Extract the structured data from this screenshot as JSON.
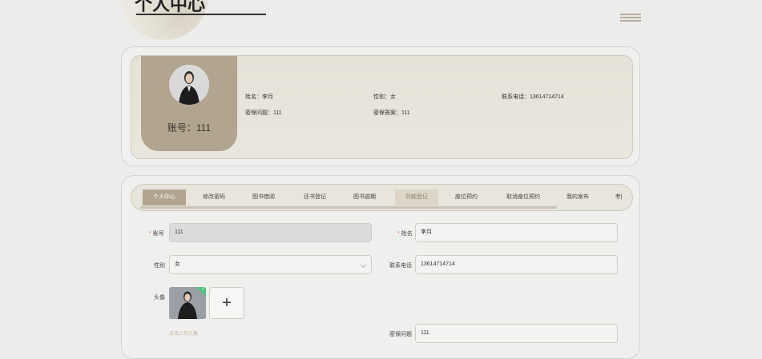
{
  "page": {
    "title": "个人中心"
  },
  "profile": {
    "account_label": "账号：",
    "account_value": "111",
    "name_label": "姓名：",
    "name_value": "李月",
    "gender_label": "性别：",
    "gender_value": "女",
    "phone_label": "联系电话：",
    "phone_value": "13614714714",
    "security_q_label": "密保问题：",
    "security_q_value": "111",
    "security_a_label": "密保答案：",
    "security_a_value": "111"
  },
  "tabs": [
    {
      "label": "个人中心"
    },
    {
      "label": "修改密码"
    },
    {
      "label": "图书借阅"
    },
    {
      "label": "还书登记"
    },
    {
      "label": "图书逾期"
    },
    {
      "label": "罚款登记"
    },
    {
      "label": "座位预约"
    },
    {
      "label": "取消座位预约"
    },
    {
      "label": "我的发布"
    },
    {
      "label": "考|"
    }
  ],
  "form": {
    "account": {
      "label": "账号",
      "value": "111"
    },
    "name": {
      "label": "姓名",
      "value": "李月"
    },
    "gender": {
      "label": "性别",
      "value": "女"
    },
    "phone": {
      "label": "联系电话",
      "value": "13614714714"
    },
    "avatar": {
      "label": "头像",
      "upload_plus": "+",
      "hint": "点击上传头像"
    },
    "security_q": {
      "label": "密保问题",
      "value": "111"
    }
  },
  "icons": {
    "menu": "hamburger-icon",
    "upload": "plus-icon",
    "check": "check-icon",
    "select": "chevron-down-icon"
  },
  "colors": {
    "accent": "#b2a58f",
    "card_bg": "#e8e5dd",
    "required": "#e06b6b",
    "success": "#4cc27a"
  }
}
